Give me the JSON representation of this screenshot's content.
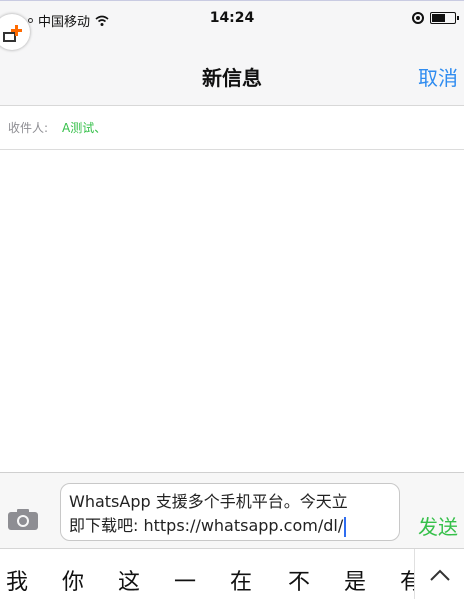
{
  "status_bar": {
    "carrier": "中国移动",
    "time": "14:24"
  },
  "nav": {
    "title": "新信息",
    "cancel_label": "取消"
  },
  "recipient": {
    "label": "收件人:",
    "value": "A测试、"
  },
  "composer": {
    "line1": "WhatsApp 支援多个手机平台。今天立",
    "line2": "即下载吧: https://whatsapp.com/dl/",
    "send_label": "发送"
  },
  "keyboard": {
    "candidates": [
      "我",
      "你",
      "这",
      "一",
      "在",
      "不",
      "是",
      "有"
    ]
  },
  "colors": {
    "accent_blue": "#2f8cf0",
    "accent_green": "#36c04a",
    "badge_orange": "#ff6a00"
  },
  "icons": {
    "add": "add-icon",
    "camera": "camera-icon",
    "expand": "chevron-up-icon",
    "wifi": "wifi-icon",
    "battery": "battery-icon",
    "orientation": "orientation-lock-icon"
  }
}
